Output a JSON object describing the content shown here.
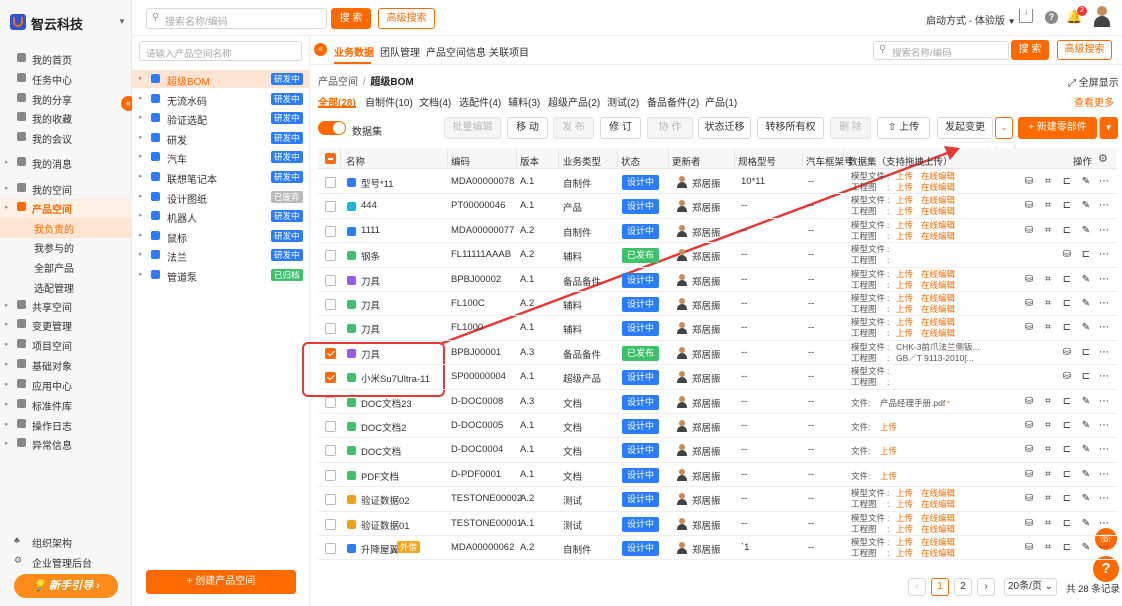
{
  "brand": {
    "name": "智云科技"
  },
  "top": {
    "search_placeholder": "搜索名称/编码",
    "search_btn": "搜 索",
    "adv_btn": "高级搜索",
    "launch": "启动方式 - 体验版",
    "notif_count": "2"
  },
  "nav": [
    {
      "label": "我的首页",
      "icon": "home-icon"
    },
    {
      "label": "任务中心",
      "icon": "task-icon"
    },
    {
      "label": "我的分享",
      "icon": "share-icon"
    },
    {
      "label": "我的收藏",
      "icon": "star-icon"
    },
    {
      "label": "我的会议",
      "icon": "meeting-icon"
    },
    {
      "label": "我的消息",
      "icon": "bell-icon"
    },
    {
      "label": "我的空间",
      "icon": "space-icon"
    },
    {
      "label": "产品空间",
      "icon": "product-icon",
      "active": true
    },
    {
      "label": "我负责的",
      "sub": true,
      "active": true
    },
    {
      "label": "我参与的",
      "sub": true
    },
    {
      "label": "全部产品",
      "sub": true
    },
    {
      "label": "选配管理",
      "sub": true
    },
    {
      "label": "共享空间",
      "icon": "share-space-icon"
    },
    {
      "label": "变更管理",
      "icon": "change-icon"
    },
    {
      "label": "项目空间",
      "icon": "project-icon"
    },
    {
      "label": "基础对象",
      "icon": "base-icon"
    },
    {
      "label": "应用中心",
      "icon": "app-icon"
    },
    {
      "label": "标准件库",
      "icon": "std-icon"
    },
    {
      "label": "操作日志",
      "icon": "log-icon"
    },
    {
      "label": "异常信息",
      "icon": "warn-icon"
    }
  ],
  "nav_bottom": {
    "org": "组织架构",
    "admin": "企业管理后台",
    "guide": "新手引导"
  },
  "tree": {
    "placeholder": "请输入产品空间名称",
    "create": "+ 创建产品空间",
    "items": [
      {
        "label": "超级BOM",
        "tag": "研发中",
        "tagc": "#2b7cff",
        "active": true
      },
      {
        "label": "无流水码",
        "tag": "研发中",
        "tagc": "#2b7cff"
      },
      {
        "label": "验证选配",
        "tag": "研发中",
        "tagc": "#2b7cff"
      },
      {
        "label": "研发",
        "tag": "研发中",
        "tagc": "#2b7cff"
      },
      {
        "label": "汽车",
        "tag": "研发中",
        "tagc": "#2b7cff"
      },
      {
        "label": "联想笔记本",
        "tag": "研发中",
        "tagc": "#2b7cff"
      },
      {
        "label": "设计图纸",
        "tag": "已废弃",
        "tagc": "#bbbbbb"
      },
      {
        "label": "机器人",
        "tag": "研发中",
        "tagc": "#2b7cff"
      },
      {
        "label": "鼠标",
        "tag": "研发中",
        "tagc": "#2b7cff"
      },
      {
        "label": "法兰",
        "tag": "研发中",
        "tagc": "#2b7cff"
      },
      {
        "label": "管道泵",
        "tag": "已归档",
        "tagc": "#3ec16a"
      }
    ]
  },
  "tabs": [
    "业务数据",
    "团队管理",
    "产品空间信息",
    "关联项目"
  ],
  "main": {
    "search_placeholder": "搜索名称/编码",
    "search_btn": "搜 索",
    "adv_btn": "高级搜索",
    "crumb_root": "产品空间",
    "crumb_sep": "/",
    "crumb_cur": "超级BOM",
    "fullscreen": "全屏显示",
    "more": "查看更多",
    "dataset": "数据集"
  },
  "filters": [
    "全部(28)",
    "自制件(10)",
    "文档(4)",
    "选配件(4)",
    "辅料(3)",
    "超级产品(2)",
    "测试(2)",
    "备品备件(2)",
    "产品(1)"
  ],
  "toolbar": {
    "batch_edit": "批量编辑",
    "move": "移 动",
    "publish": "发 布",
    "revise": "修 订",
    "collab": "协 作",
    "state": "状态迁移",
    "transfer": "转移所有权",
    "delete": "删 除",
    "upload": "上传",
    "change": "发起变更",
    "new_part": "+ 新建零部件",
    "tooltip": "添加到已有变更"
  },
  "columns": [
    "名称",
    "编码",
    "版本",
    "业务类型",
    "状态",
    "更新者",
    "规格型号",
    "汽车框架号",
    "数据集（支持拖拽上传）",
    "操作"
  ],
  "rows": [
    {
      "name": "型号*11",
      "code": "MDA00000078",
      "ver": "A.1",
      "type": "自制件",
      "status": "设计中",
      "sc": "b",
      "user": "郑居振",
      "spec": "10*11",
      "frame": "--",
      "ds": "model",
      "icon": "#2b7cff"
    },
    {
      "name": "444",
      "code": "PT00000046",
      "ver": "A.1",
      "type": "产品",
      "status": "设计中",
      "sc": "b",
      "user": "郑居振",
      "spec": "--",
      "frame": "--",
      "ds": "model",
      "icon": "#1fb5e0"
    },
    {
      "name": "1111",
      "code": "MDA00000077",
      "ver": "A.2",
      "type": "自制件",
      "status": "设计中",
      "sc": "b",
      "user": "郑居振",
      "spec": "--",
      "frame": "--",
      "ds": "model",
      "icon": "#2b7cff"
    },
    {
      "name": "钢条",
      "code": "FL11111AAAB",
      "ver": "A.2",
      "type": "辅料",
      "status": "已发布",
      "sc": "g",
      "user": "郑居振",
      "spec": "--",
      "frame": "--",
      "ds": "empty",
      "icon": "#3ec16a"
    },
    {
      "name": "刀具",
      "code": "BPBJ00002",
      "ver": "A.1",
      "type": "备品备件",
      "status": "设计中",
      "sc": "b",
      "user": "郑居振",
      "spec": "--",
      "frame": "--",
      "ds": "model",
      "icon": "#9b59f0"
    },
    {
      "name": "刀具",
      "code": "FL100C",
      "ver": "A.2",
      "type": "辅料",
      "status": "设计中",
      "sc": "b",
      "user": "郑居振",
      "spec": "--",
      "frame": "--",
      "ds": "model",
      "icon": "#3ec16a"
    },
    {
      "name": "刀具",
      "code": "FL1000",
      "ver": "A.1",
      "type": "辅料",
      "status": "设计中",
      "sc": "b",
      "user": "郑居振",
      "spec": "--",
      "frame": "--",
      "ds": "model",
      "icon": "#3ec16a"
    },
    {
      "name": "刀具",
      "code": "BPBJ00001",
      "ver": "A.3",
      "type": "备品备件",
      "status": "已发布",
      "sc": "g",
      "user": "郑居振",
      "spec": "--",
      "frame": "--",
      "ds": "chk",
      "icon": "#9b59f0",
      "checked": true
    },
    {
      "name": "小米Su7Ultra-11",
      "code": "SP00000004",
      "ver": "A.1",
      "type": "超级产品",
      "status": "设计中",
      "sc": "b",
      "user": "郑居振",
      "spec": "--",
      "frame": "--",
      "ds": "empty",
      "icon": "#3ec16a",
      "checked": true
    },
    {
      "name": "DOC文档23",
      "code": "D-DOC0008",
      "ver": "A.3",
      "type": "文档",
      "status": "设计中",
      "sc": "b",
      "user": "郑居振",
      "spec": "--",
      "frame": "--",
      "ds": "file",
      "icon": "#3ec16a"
    },
    {
      "name": "DOC文档2",
      "code": "D-DOC0005",
      "ver": "A.1",
      "type": "文档",
      "status": "设计中",
      "sc": "b",
      "user": "郑居振",
      "spec": "--",
      "frame": "--",
      "ds": "upload",
      "icon": "#3ec16a"
    },
    {
      "name": "DOC文档",
      "code": "D-DOC0004",
      "ver": "A.1",
      "type": "文档",
      "status": "设计中",
      "sc": "b",
      "user": "郑居振",
      "spec": "--",
      "frame": "--",
      "ds": "upload",
      "icon": "#3ec16a"
    },
    {
      "name": "PDF文档",
      "code": "D-PDF0001",
      "ver": "A.1",
      "type": "文档",
      "status": "设计中",
      "sc": "b",
      "user": "郑居振",
      "spec": "--",
      "frame": "--",
      "ds": "upload",
      "icon": "#3ec16a"
    },
    {
      "name": "验证数据02",
      "code": "TESTONE00002",
      "ver": "A.2",
      "type": "测试",
      "status": "设计中",
      "sc": "b",
      "user": "郑居振",
      "spec": "--",
      "frame": "--",
      "ds": "model",
      "icon": "#f0a020"
    },
    {
      "name": "验证数据01",
      "code": "TESTONE00001",
      "ver": "A.1",
      "type": "测试",
      "status": "设计中",
      "sc": "b",
      "user": "郑居振",
      "spec": "--",
      "frame": "--",
      "ds": "model",
      "icon": "#f0a020"
    },
    {
      "name": "升降屋翼",
      "code": "MDA00000062",
      "ver": "A.2",
      "type": "自制件",
      "status": "设计中",
      "sc": "b",
      "user": "郑居振",
      "spec": "`1",
      "frame": "--",
      "ds": "model",
      "icon": "#2b7cff",
      "extra": "外借"
    }
  ],
  "ds_text": {
    "model": "模型文件",
    "draw": "工程图",
    "colon": ":",
    "upload": "上传",
    "edit": "在线编辑",
    "file": "文件:",
    "fname": "产品经理手册.pdf",
    "chk_model": "CHK-3前爪法兰侧钣...",
    "chk_draw": "GB／T 9113-2010[..."
  },
  "pager": {
    "p1": "1",
    "p2": "2",
    "size": "20条/页",
    "total": "共 28 条记录"
  }
}
